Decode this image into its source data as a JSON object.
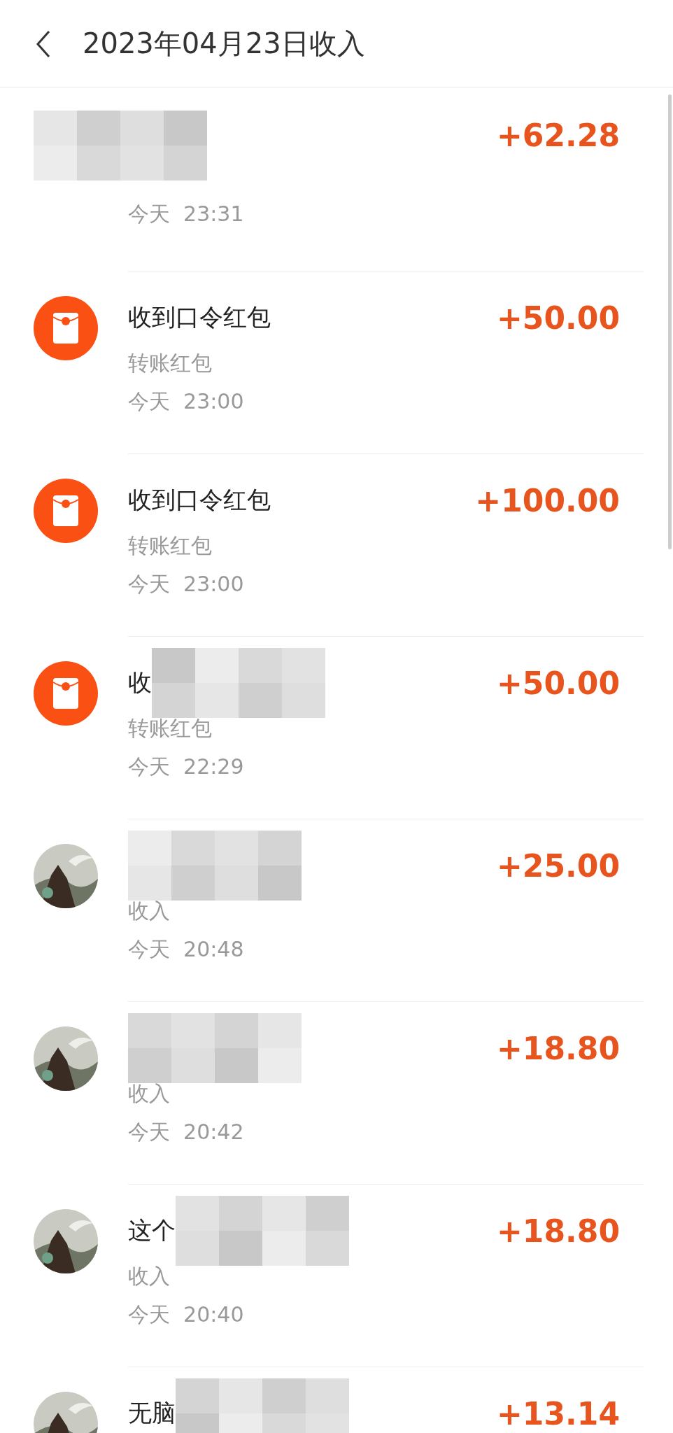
{
  "header": {
    "title": "2023年04月23日收入"
  },
  "records": [
    {
      "kind": "hidden",
      "redacted": true,
      "time": "今天  23:31",
      "amount": "+62.28"
    },
    {
      "kind": "packet",
      "redacted": false,
      "title": "收到口令红包",
      "subtitle": "转账红包",
      "time": "今天  23:00",
      "amount": "+50.00"
    },
    {
      "kind": "packet",
      "redacted": false,
      "title": "收到口令红包",
      "subtitle": "转账红包",
      "time": "今天  23:00",
      "amount": "+100.00"
    },
    {
      "kind": "packet",
      "redacted": true,
      "title": "收",
      "subtitle": "转账红包",
      "time": "今天  22:29",
      "amount": "+50.00"
    },
    {
      "kind": "avatar",
      "redacted": true,
      "subtitle": "收入",
      "time": "今天  20:48",
      "amount": "+25.00"
    },
    {
      "kind": "avatar",
      "redacted": true,
      "subtitle": "收入",
      "time": "今天  20:42",
      "amount": "+18.80"
    },
    {
      "kind": "avatar",
      "redacted": true,
      "title": "这个",
      "subtitle": "收入",
      "time": "今天  20:40",
      "amount": "+18.80"
    },
    {
      "kind": "avatar",
      "redacted": true,
      "title": "无脑",
      "amount": "+13.14"
    }
  ]
}
